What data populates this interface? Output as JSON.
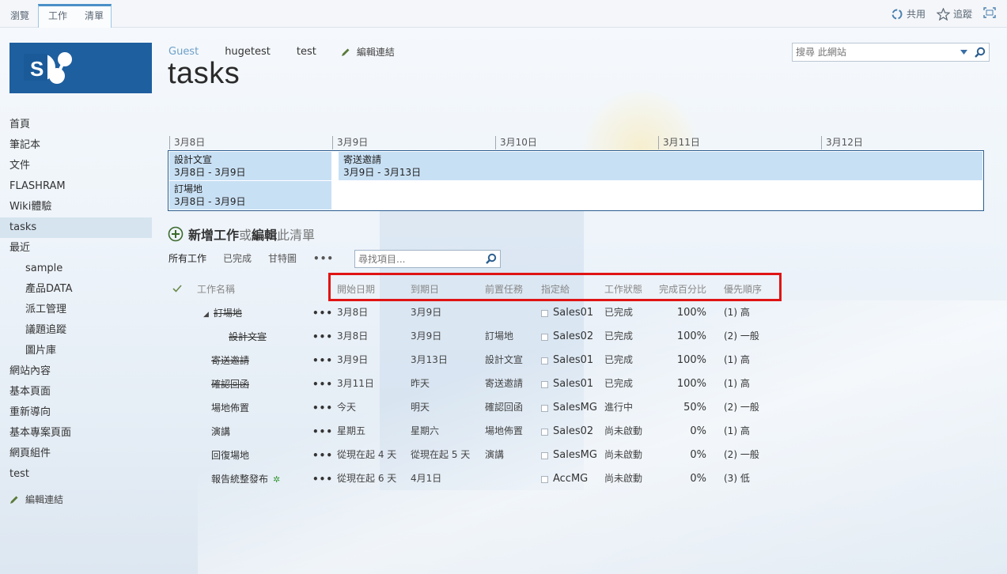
{
  "suite": {
    "tabs": [
      "瀏覽",
      "工作",
      "清單"
    ],
    "share": "共用",
    "follow": "追蹤"
  },
  "header": {
    "breadcrumb": [
      "Guest",
      "hugetest",
      "test"
    ],
    "edit_links": "編輯連結",
    "title": "tasks",
    "search_placeholder": "搜尋 此網站"
  },
  "nav": {
    "items": [
      {
        "label": "首頁",
        "sub": false,
        "selected": false
      },
      {
        "label": "筆記本",
        "sub": false,
        "selected": false
      },
      {
        "label": "文件",
        "sub": false,
        "selected": false
      },
      {
        "label": "FLASHRAM",
        "sub": false,
        "selected": false
      },
      {
        "label": "Wiki體驗",
        "sub": false,
        "selected": false
      },
      {
        "label": "tasks",
        "sub": false,
        "selected": true
      },
      {
        "label": "最近",
        "sub": false,
        "selected": false
      },
      {
        "label": "sample",
        "sub": true,
        "selected": false
      },
      {
        "label": "產品DATA",
        "sub": true,
        "selected": false
      },
      {
        "label": "派工管理",
        "sub": true,
        "selected": false
      },
      {
        "label": "議題追蹤",
        "sub": true,
        "selected": false
      },
      {
        "label": "圖片庫",
        "sub": true,
        "selected": false
      },
      {
        "label": "網站內容",
        "sub": false,
        "selected": false
      },
      {
        "label": "基本頁面",
        "sub": false,
        "selected": false
      },
      {
        "label": "重新導向",
        "sub": false,
        "selected": false
      },
      {
        "label": "基本專案頁面",
        "sub": false,
        "selected": false
      },
      {
        "label": "網頁組件",
        "sub": false,
        "selected": false
      },
      {
        "label": "test",
        "sub": false,
        "selected": false
      }
    ],
    "edit_links": "編輯連結"
  },
  "timeline": {
    "dates": [
      "3月8日",
      "3月9日",
      "3月10日",
      "3月11日",
      "3月12日"
    ],
    "bars": [
      {
        "name": "設計文宣",
        "range": "3月8日 - 3月9日"
      },
      {
        "name": "寄送邀請",
        "range": "3月9日 - 3月13日"
      },
      {
        "name": "訂場地",
        "range": "3月8日 - 3月9日"
      }
    ]
  },
  "list": {
    "add_new": {
      "new_task": "新增工作",
      "or": "或",
      "edit": "編輯",
      "this_list": "此清單"
    },
    "views": [
      "所有工作",
      "已完成",
      "甘特圖"
    ],
    "view_more": "•••",
    "search_placeholder": "尋找項目...",
    "columns": {
      "name": "工作名稱",
      "start": "開始日期",
      "due": "到期日",
      "predecessors": "前置任務",
      "assigned": "指定給",
      "status": "工作狀態",
      "percent": "完成百分比",
      "priority": "優先順序"
    },
    "rows": [
      {
        "name": "訂場地",
        "done": true,
        "indent": 1,
        "expander": true,
        "new": false,
        "start": "3月8日",
        "due": "3月9日",
        "pred": "",
        "assigned": "Sales01",
        "status": "已完成",
        "percent": "100%",
        "priority": "(1) 高"
      },
      {
        "name": "設計文宣",
        "done": true,
        "indent": 2,
        "expander": false,
        "new": false,
        "start": "3月8日",
        "due": "3月9日",
        "pred": "訂場地",
        "assigned": "Sales02",
        "status": "已完成",
        "percent": "100%",
        "priority": "(2) 一般"
      },
      {
        "name": "寄送邀請",
        "done": true,
        "indent": 0,
        "expander": false,
        "new": false,
        "start": "3月9日",
        "due": "3月13日",
        "pred": "設計文宣",
        "assigned": "Sales01",
        "status": "已完成",
        "percent": "100%",
        "priority": "(1) 高"
      },
      {
        "name": "確認回函",
        "done": true,
        "indent": 0,
        "expander": false,
        "new": false,
        "start": "3月11日",
        "due": "昨天",
        "pred": "寄送邀請",
        "assigned": "Sales01",
        "status": "已完成",
        "percent": "100%",
        "priority": "(1) 高"
      },
      {
        "name": "場地佈置",
        "done": false,
        "indent": 0,
        "expander": false,
        "new": false,
        "start": "今天",
        "due": "明天",
        "pred": "確認回函",
        "assigned": "SalesMG",
        "status": "進行中",
        "percent": "50%",
        "priority": "(2) 一般"
      },
      {
        "name": "演講",
        "done": false,
        "indent": 0,
        "expander": false,
        "new": false,
        "start": "星期五",
        "due": "星期六",
        "pred": "場地佈置",
        "assigned": "Sales02",
        "status": "尚未啟動",
        "percent": "0%",
        "priority": "(1) 高"
      },
      {
        "name": "回復場地",
        "done": false,
        "indent": 0,
        "expander": false,
        "new": false,
        "start": "從現在起 4 天",
        "due": "從現在起 5 天",
        "pred": "演講",
        "assigned": "SalesMG",
        "status": "尚未啟動",
        "percent": "0%",
        "priority": "(2) 一般"
      },
      {
        "name": "報告統整發布",
        "done": false,
        "indent": 0,
        "expander": false,
        "new": true,
        "start": "從現在起 6 天",
        "due": "4月1日",
        "pred": "",
        "assigned": "AccMG",
        "status": "尚未啟動",
        "percent": "0%",
        "priority": "(3) 低"
      }
    ],
    "new_mark": "✲",
    "expander_glyph": "◢"
  },
  "colors": {
    "logo_bg": "#1e5f9f",
    "accent": "#4a90c8",
    "timeline_bar": "#c8e0f4",
    "highlight": "#e01414",
    "new_green": "#3a9a3a"
  }
}
